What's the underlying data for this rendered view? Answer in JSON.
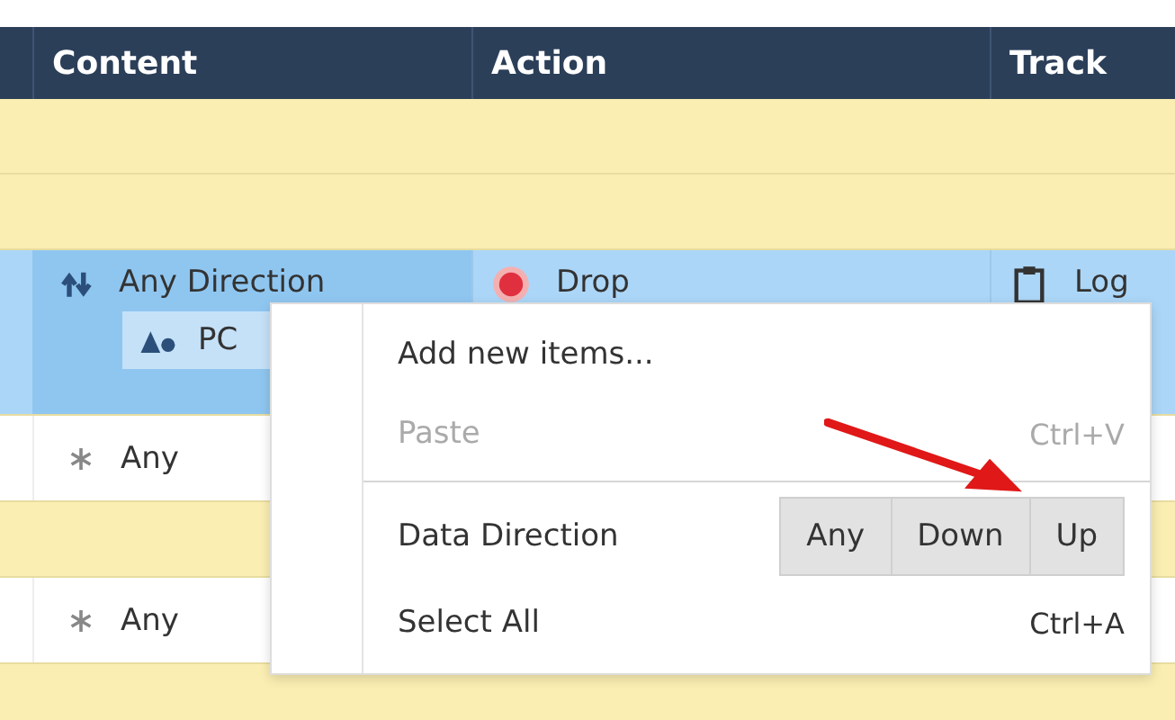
{
  "table": {
    "columns": [
      "Content",
      "Action",
      "Track"
    ],
    "rows": [
      {
        "kind": "blank"
      },
      {
        "kind": "blank"
      },
      {
        "kind": "group",
        "selected": true,
        "content": "Any Direction",
        "sub": "PC",
        "action": "Drop",
        "track": "Log"
      },
      {
        "kind": "item",
        "selected": false,
        "content": "Any"
      },
      {
        "kind": "blank"
      },
      {
        "kind": "item",
        "selected": false,
        "content": "Any"
      },
      {
        "kind": "blank"
      }
    ]
  },
  "context_menu": {
    "items": [
      {
        "kind": "command",
        "label": "Add new items...",
        "disabled": false
      },
      {
        "kind": "command",
        "label": "Paste",
        "shortcut": "Ctrl+V",
        "disabled": true
      },
      {
        "kind": "separator"
      },
      {
        "kind": "segmented",
        "label": "Data Direction",
        "options": [
          {
            "label": "Any",
            "selected": false
          },
          {
            "label": "Down",
            "selected": false
          },
          {
            "label": "Up",
            "selected": false
          }
        ]
      },
      {
        "kind": "command",
        "label": "Select All",
        "shortcut": "Ctrl+A",
        "disabled": false
      }
    ]
  }
}
